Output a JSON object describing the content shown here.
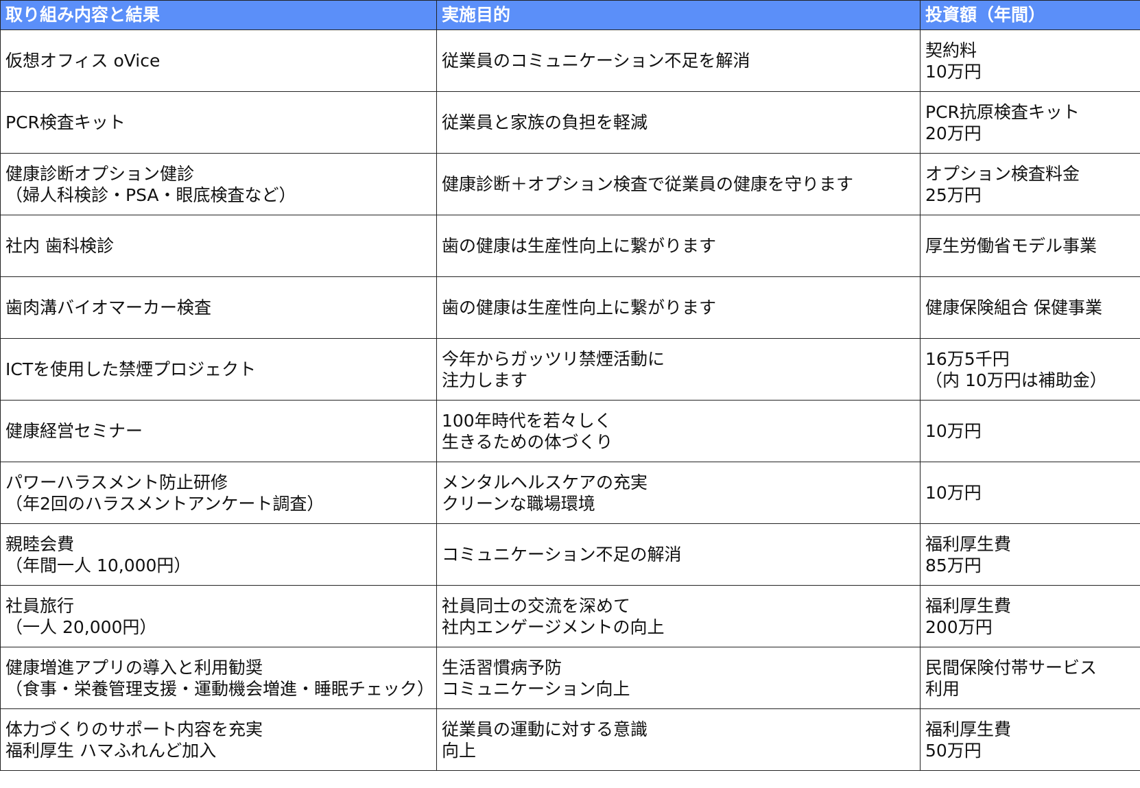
{
  "table": {
    "headers": [
      "取り組み内容と結果",
      "実施目的",
      "投資額（年間）"
    ],
    "rows": [
      [
        "仮想オフィス oVice",
        "従業員のコミュニケーション不足を解消",
        "契約料\n10万円"
      ],
      [
        "PCR検査キット",
        "従業員と家族の負担を軽減",
        "PCR抗原検査キット\n20万円"
      ],
      [
        "健康診断オプション健診\n（婦人科検診・PSA・眼底検査など）",
        "健康診断＋オプション検査で従業員の健康を守ります",
        "オプション検査料金\n25万円"
      ],
      [
        "社内 歯科検診",
        "歯の健康は生産性向上に繋がります",
        "厚生労働省モデル事業"
      ],
      [
        "歯肉溝バイオマーカー検査",
        "歯の健康は生産性向上に繋がります",
        "健康保険組合 保健事業"
      ],
      [
        "ICTを使用した禁煙プロジェクト",
        "今年からガッツリ禁煙活動に\n注力します",
        "16万5千円\n（内 10万円は補助金）"
      ],
      [
        "健康経営セミナー",
        "100年時代を若々しく\n生きるための体づくり",
        "10万円"
      ],
      [
        "パワーハラスメント防止研修\n（年2回のハラスメントアンケート調査）",
        "メンタルヘルスケアの充実\nクリーンな職場環境",
        "10万円"
      ],
      [
        "親睦会費\n（年間一人 10,000円）",
        "コミュニケーション不足の解消",
        "福利厚生費\n85万円"
      ],
      [
        "社員旅行\n（一人 20,000円）",
        "社員同士の交流を深めて\n社内エンゲージメントの向上",
        "福利厚生費\n200万円"
      ],
      [
        "健康増進アプリの導入と利用勧奨\n（食事・栄養管理支援・運動機会増進・睡眠チェック）",
        "生活習慣病予防\nコミュニケーション向上",
        "民間保険付帯サービス\n利用"
      ],
      [
        "体力づくりのサポート内容を充実\n福利厚生 ハマふれんど加入",
        "従業員の運動に対する意識\n向上",
        "福利厚生費\n50万円"
      ]
    ]
  }
}
